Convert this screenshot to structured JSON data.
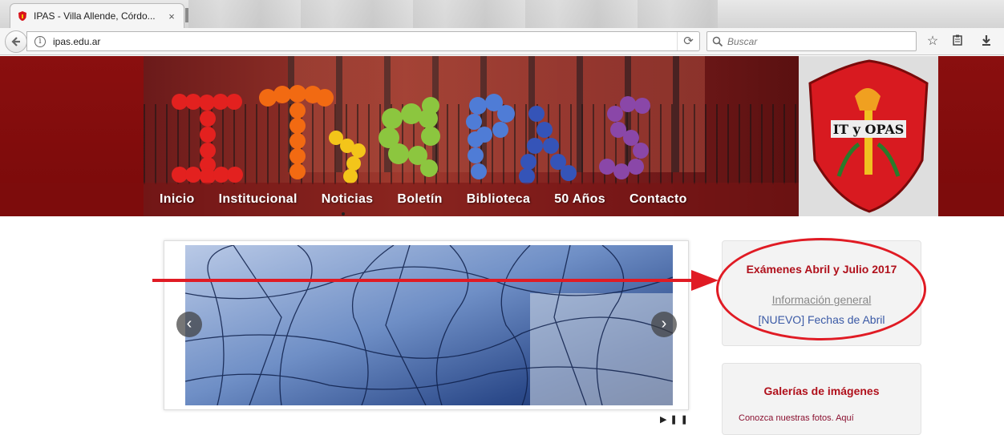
{
  "browser": {
    "tab_title": "IPAS - Villa Allende, Córdo...",
    "tab_close": "×",
    "url": "ipas.edu.ar",
    "search_placeholder": "Buscar",
    "info_glyph": "i",
    "reload_glyph": "⟳"
  },
  "icons": {
    "back": "back-arrow-icon",
    "bookmark": "star-icon",
    "reading_list": "clipboard-icon",
    "download": "download-icon",
    "search": "magnifier-icon"
  },
  "site": {
    "banner_text": "IT y OPAS",
    "shield_label": "IT y OPAS",
    "menu": [
      "Inicio",
      "Institucional",
      "Noticias",
      "Boletín",
      "Biblioteca",
      "50 Años",
      "Contacto"
    ]
  },
  "slider": {
    "prev": "‹",
    "next": "›",
    "controls": "▶❚❚"
  },
  "sidebar": {
    "exams": {
      "title": "Exámenes Abril y Julio 2017",
      "link1": "Información general",
      "link2": "[NUEVO] Fechas de Abril"
    },
    "gallery": {
      "title": "Galerías de imágenes",
      "text": "Conozca nuestras fotos. Aquí"
    }
  },
  "colors": {
    "brand_red": "#8a0f0f",
    "link_red": "#b0101b",
    "annotation_red": "#e01b24",
    "link_blue": "#3b5aa6"
  }
}
